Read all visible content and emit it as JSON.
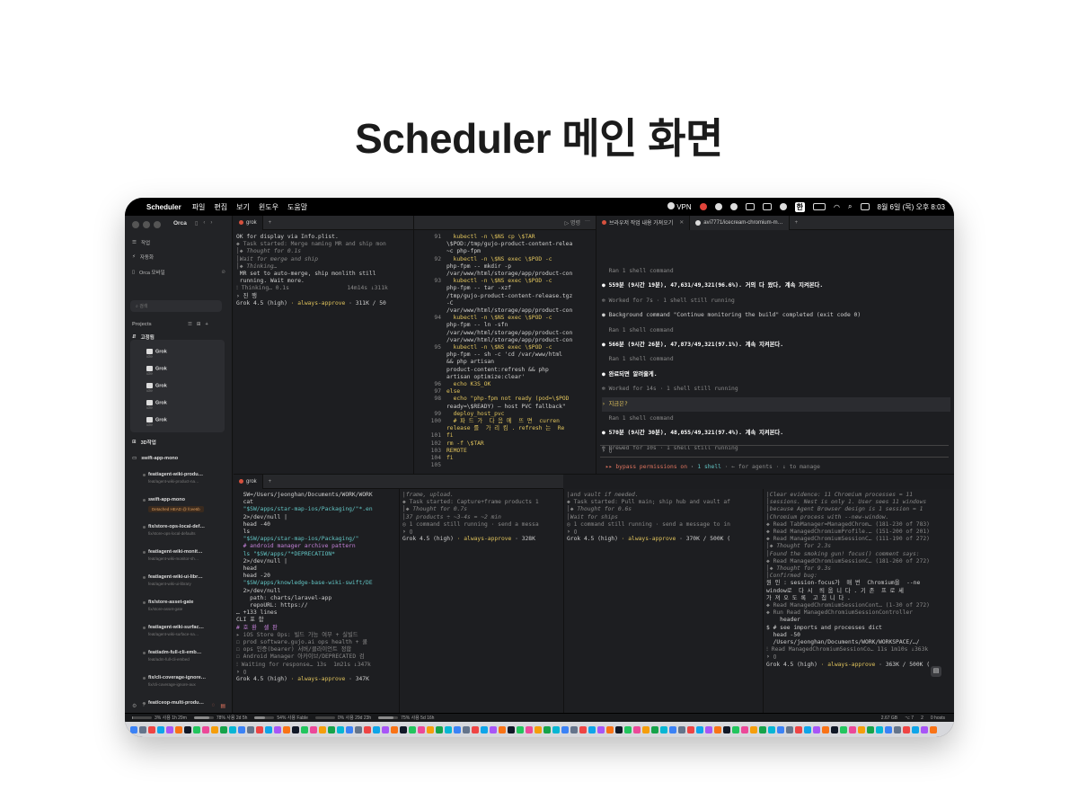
{
  "headline": "Scheduler 메인 화면",
  "menubar": {
    "app": "Scheduler",
    "items": [
      "파일",
      "편집",
      "보기",
      "윈도우",
      "도움말"
    ],
    "vpn": "VPN",
    "lang": "한",
    "datetime": "8월 6일 (목) 오후 8:03"
  },
  "sidebar": {
    "title": "Orca",
    "nav": [
      "작업",
      "자동화",
      "Orca 모바일"
    ],
    "search_placeholder": "검색",
    "projects_label": "Projects",
    "pinned_label": "고정됨",
    "pinned_items": [
      {
        "name": "Grok",
        "sub": "idle"
      },
      {
        "name": "Grok",
        "sub": "idle"
      },
      {
        "name": "Grok",
        "sub": "idle"
      },
      {
        "name": "Grok",
        "sub": "idle"
      },
      {
        "name": "Grok",
        "sub": "idle"
      }
    ],
    "group_3d": "3D작업",
    "repo": "swift-app-mono",
    "worktrees": [
      {
        "name": "feat/agent-wiki-produ…",
        "branch": "feat/agent-wiki-product-na…"
      },
      {
        "name": "swift-app-mono",
        "branch": "Detached HEAD @ fcee6b"
      },
      {
        "name": "fix/store-ops-local-def…",
        "branch": "fix/store-ops-local-defaults"
      },
      {
        "name": "feat/agent-wiki-monit…",
        "branch": "feat/agent-wiki-monitor-sh…"
      },
      {
        "name": "feat/agent-wiki-ui-libr…",
        "branch": "feat/agent-wiki-ui-library"
      },
      {
        "name": "fix/store-asset-gate",
        "branch": "fix/store-asset-gate"
      },
      {
        "name": "feat/agent-wiki-surfac…",
        "branch": "feat/agent-wiki-surface-na…"
      },
      {
        "name": "feat/adm-full-cli-emb…",
        "branch": "feat/adm-full-cli-embed"
      },
      {
        "name": "fix/cli-coverage-ignore…",
        "branch": "fix/cli-coverage-ignore-aux"
      },
      {
        "name": "feat/ceop-multi-produ…",
        "branch": ""
      }
    ]
  },
  "top_left": {
    "tab": "grok",
    "lines": [
      "OK for display via Info.plist.",
      "◆ Task started: Merge naming MR and ship mon",
      "│◆ Thought for 0.1s",
      "",
      "│Wait for merge and ship",
      "│◆ Thinking…",
      "",
      " MR set to auto-merge, ship monlith still",
      " running. Wait more.",
      "⁝ Thinking… 0.1s                 14m14s ↓311k",
      "› 진 행",
      "Grok 4.5 (high) · always-approve · 311K / 50"
    ]
  },
  "top_mid": {
    "run_label": "▷ 명령",
    "lines": [
      {
        "n": "91",
        "t": "  kubectl -n \\$NS cp \\$TAR"
      },
      {
        "n": "",
        "t": "\\$POD:/tmp/gujo-product-content-relea"
      },
      {
        "n": "",
        "t": "~c php-fpm"
      },
      {
        "n": "92",
        "t": "  kubectl -n \\$NS exec \\$POD -c"
      },
      {
        "n": "",
        "t": "php-fpm -- mkdir -p"
      },
      {
        "n": "",
        "t": "/var/www/html/storage/app/product-con"
      },
      {
        "n": "93",
        "t": "  kubectl -n \\$NS exec \\$POD -c"
      },
      {
        "n": "",
        "t": "php-fpm -- tar -xzf"
      },
      {
        "n": "",
        "t": "/tmp/gujo-product-content-release.tgz"
      },
      {
        "n": "",
        "t": "-C"
      },
      {
        "n": "",
        "t": "/var/www/html/storage/app/product-con"
      },
      {
        "n": "94",
        "t": "  kubectl -n \\$NS exec \\$POD -c"
      },
      {
        "n": "",
        "t": "php-fpm -- ln -sfn"
      },
      {
        "n": "",
        "t": "/var/www/html/storage/app/product-con"
      },
      {
        "n": "",
        "t": "/var/www/html/storage/app/product-con"
      },
      {
        "n": "95",
        "t": "  kubectl -n \\$NS exec \\$POD -c"
      },
      {
        "n": "",
        "t": "php-fpm -- sh -c 'cd /var/www/html"
      },
      {
        "n": "",
        "t": "&& php artisan"
      },
      {
        "n": "",
        "t": "product-content:refresh && php"
      },
      {
        "n": "",
        "t": "artisan optimize:clear'"
      },
      {
        "n": "96",
        "t": "  echo K3S_OK"
      },
      {
        "n": "97",
        "t": "else"
      },
      {
        "n": "98",
        "t": "  echo \"php-fpm not ready (pod=\\$POD"
      },
      {
        "n": "",
        "t": "ready=\\$READY) — host PVC fallback\""
      },
      {
        "n": "99",
        "t": "  deploy_host_pvc"
      },
      {
        "n": "100",
        "t": "  # 파 드 가  다 음 에  뜨 면  curren"
      },
      {
        "n": "",
        "t": "release 를  가 리 킴 . refresh 는  Re"
      },
      {
        "n": "101",
        "t": "fi"
      },
      {
        "n": "102",
        "t": "rm -f \\$TAR"
      },
      {
        "n": "103",
        "t": "REMOTE"
      },
      {
        "n": "104",
        "t": "fi"
      },
      {
        "n": "105",
        "t": ""
      }
    ]
  },
  "top_right": {
    "tabs": [
      "브라우저 작업 내용 가져오기",
      "avi7771/icecream-chromium-m…"
    ],
    "lines": [
      {
        "k": "g",
        "t": "  Ran 1 shell command"
      },
      {
        "k": "w",
        "t": "● 559분 (9시간 19분), 47,631/49,321(96.6%). 거의 다 왔다, 계속 지켜본다."
      },
      {
        "k": "g",
        "t": "✻ Worked for 7s · 1 shell still running"
      },
      {
        "k": "n",
        "t": "● Background command \"Continue monitoring the build\" completed (exit code 0)"
      },
      {
        "k": "g",
        "t": "  Ran 1 shell command"
      },
      {
        "k": "w",
        "t": "● 566분 (9시간 26분), 47,873/49,321(97.1%). 계속 지켜본다."
      },
      {
        "k": "g",
        "t": "  Ran 1 shell command"
      },
      {
        "k": "w",
        "t": "● 완료되면 알려줄게."
      },
      {
        "k": "g",
        "t": "✻ Worked for 14s · 1 shell still running"
      },
      {
        "k": "hl",
        "t": "› 지금은?"
      },
      {
        "k": "g",
        "t": "  Ran 1 shell command"
      },
      {
        "k": "w",
        "t": "● 570분 (9시간 30분), 48,055/49,321(97.4%). 계속 지켜본다."
      },
      {
        "k": "g",
        "t": "✻ Brewed for 10s · 1 shell still running"
      }
    ],
    "prompt": "› ▯",
    "footer_red": "▸▸ bypass permissions on",
    "footer_blue": "1 shell",
    "footer_rest": "· ← for agents · ↓ to manage"
  },
  "bottom1": {
    "tab": "grok",
    "lines": [
      "  SW=/Users/jeonghan/Documents/WORK/WORK",
      "  cat",
      "  \"$SW/apps/star-map-ios/Packaging/\"*.en",
      "  2>/dev/null |",
      "  head -40",
      "  ls",
      "  \"$SW/apps/star-map-ios/Packaging/\"",
      "  # android manager archive pattern",
      "  ls \"$SW/apps/\"*DEPRECATION*",
      "  2>/dev/null |",
      "  head",
      "  head -20",
      "  \"$SW/apps/knowledge-base-wiki-swift/DE",
      "  2>/dev/null",
      "",
      "    path: charts/laravel-app",
      "    repoURL: https://",
      "… +133 lines",
      "CLI 포 함",
      "",
      "# 호 환  셀 판",
      "▸ iOS Store Ops: 빌드 가능 여부 + 실빌드",
      "☐ prod software.gujo.ai ops health + 쿨",
      "☐ ops 인증(bearer) 서버/클라이언트 정합",
      "☐ Android Manager 아카이브/DEPRECATED 검",
      "⁝ Waiting for response… 13s  1m21s ↓347k",
      "› ▯",
      "Grok 4.5 (high) · always-approve · 347K"
    ]
  },
  "bottom2": {
    "lines": [
      "│frame, upload.",
      "◆ Task started: Capture+frame products 1",
      "│◆ Thought for 0.7s",
      "",
      "│37 products ÷ ~3-4s = ~2 min",
      "◎ 1 command still running · send a messa",
      "› ▯",
      "Grok 4.5 (high) · always-approve · 328K"
    ]
  },
  "bottom3": {
    "lines": [
      "│and vault if needed.",
      "◆ Task started: Pull main; ship hub and vault af",
      "│◆ Thought for 0.6s",
      "",
      "│Wait for ships",
      "◎ 1 command still running · send a message to in",
      "› ▯",
      "Grok 4.5 (high) · always-approve · 370K / 500K ("
    ]
  },
  "bottom4": {
    "lines": [
      "│Clear evidence: 11 Chromium processes = 11",
      "│sessions. Nest is only 1. User sees 11 windows",
      "│because Agent Browser design is 1 session = 1",
      "│Chromium process with --new-window.",
      "◆ Read TabManager=ManagedChrom… (181-230 of 783)",
      "◆ Read ManagedChromiumProfile.… (151-200 of 201)",
      "◆ Read ManagedChromiumSessionC… (111-190 of 272)",
      "│◆ Thought for 2.3s",
      "",
      "│Found the smoking gun! focus() comment says:",
      "◆ Read ManagedChromiumSessionC… (181-260 of 272)",
      "│◆ Thought for 9.3s",
      "",
      "│Confirmed bug:",
      "",
      "원 인 : session-focus가  매 번  Chromium을  --ne",
      "window로  다 시  띄 웁 니 다 . 기 존  프 로 세",
      "가 져 오 도 록  고 칩 니 다 .",
      "◆ Read ManagedChromiumSessionCont… (1-30 of 272)",
      "◆ Run Read ManagedChromiumSessionController",
      "    header",
      "$ # see imports and processes dict",
      "  head -50",
      "  /Users/jeonghan/Documents/WORK/WORKSPACE/…/",
      "⁝ Read ManagedChromiumSessionCo… 11s 1m10s ↓363k",
      "› ▯",
      "Grok 4.5 (high) · always-approve · 363K / 500K ("
    ]
  },
  "statusbar": {
    "items": [
      {
        "label": "3% 사용 1h 29m",
        "pct": 3
      },
      {
        "label": "78% 사용 2d 5h",
        "pct": 78
      },
      {
        "label": "54% 사용 Fable",
        "pct": 54
      },
      {
        "label": "0% 사용 29d 23h",
        "pct": 0
      },
      {
        "label": "75% 사용 5d 16h",
        "pct": 75
      }
    ],
    "right": [
      "2.67 GB",
      "⌥ 7",
      "2",
      "0 hosts"
    ]
  },
  "colors": {
    "accent_red": "#e0745f",
    "accent_blue": "#7aa7ff",
    "accent_yellow": "#e0c35c",
    "accent_teal": "#62c4c3"
  }
}
